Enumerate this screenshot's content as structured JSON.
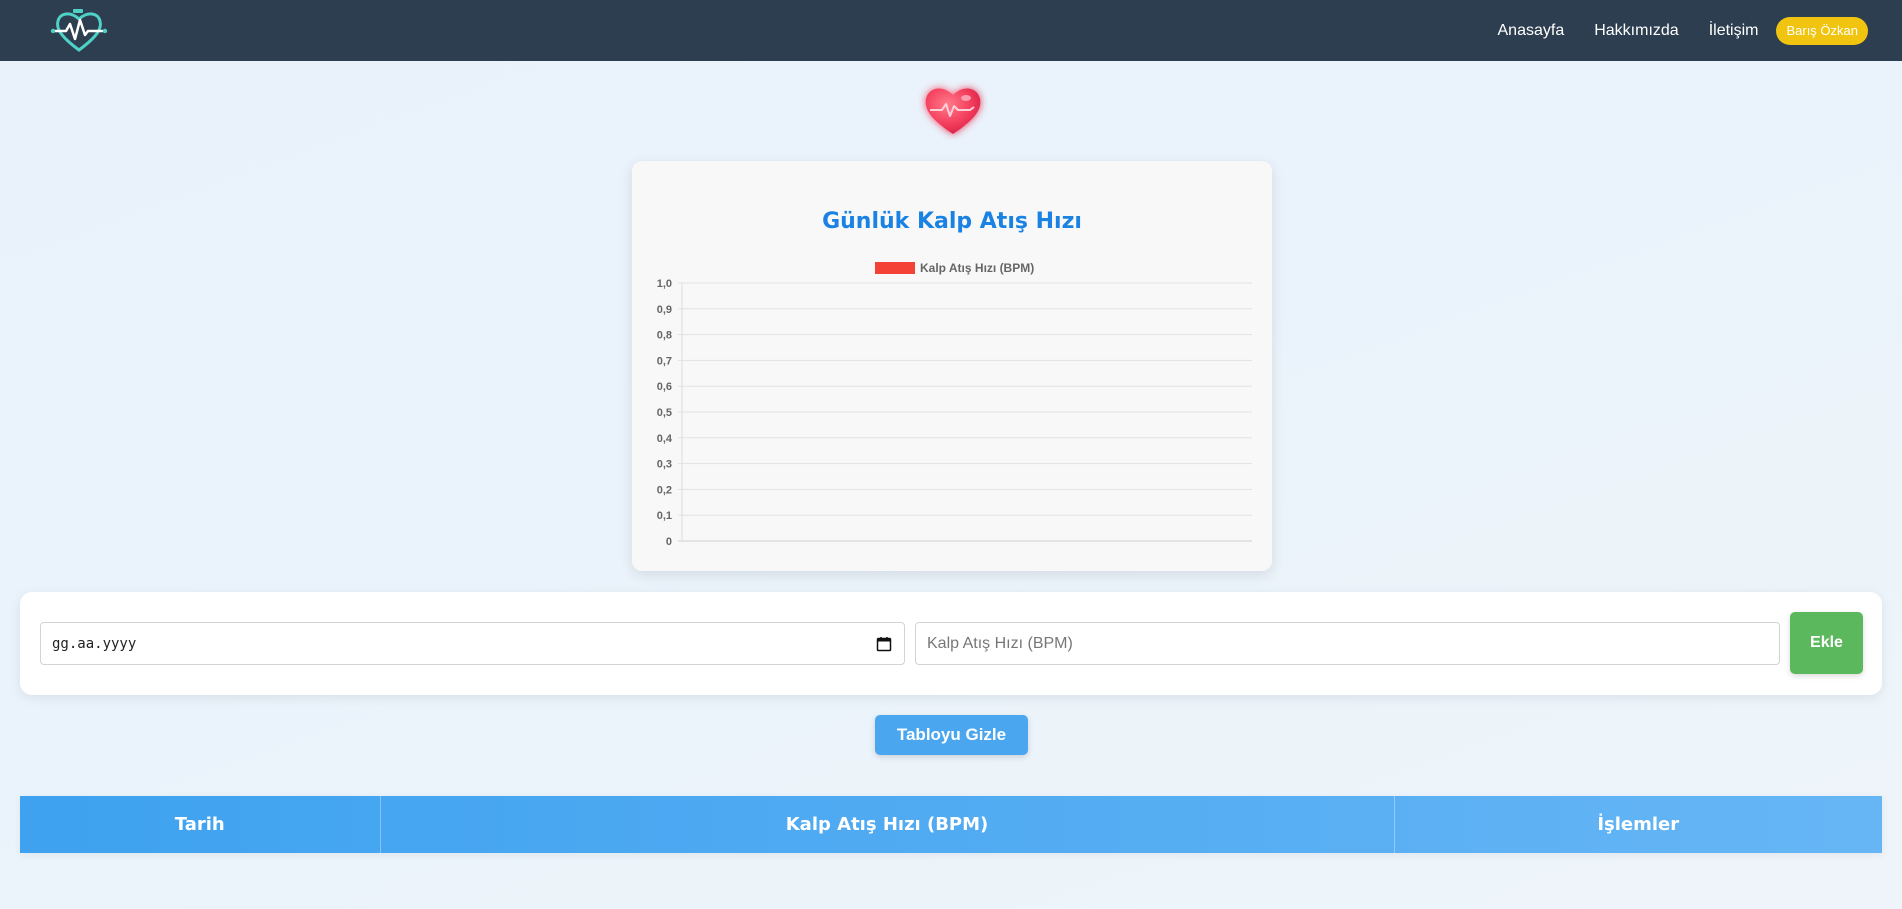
{
  "navbar": {
    "links": [
      "Anasayfa",
      "Hakkımızda",
      "İletişim"
    ],
    "user": "Barış Özkan",
    "bg_color": "#2c3e50",
    "user_badge_color": "#f1c40f"
  },
  "chart_data": {
    "type": "line",
    "title": "Günlük Kalp Atış Hızı",
    "series": [
      {
        "name": "Kalp Atış Hızı (BPM)",
        "color": "#f44336",
        "values": []
      }
    ],
    "categories": [],
    "ylim": [
      0,
      1
    ],
    "yticks": [
      "0",
      "0,1",
      "0,2",
      "0,3",
      "0,4",
      "0,5",
      "0,6",
      "0,7",
      "0,8",
      "0,9",
      "1,0"
    ],
    "grid": true,
    "legend": "top"
  },
  "form": {
    "date_placeholder": "gg.aa.yyyy",
    "bpm_placeholder": "Kalp Atış Hızı (BPM)",
    "add_label": "Ekle"
  },
  "toggle_table_label": "Tabloyu Gizle",
  "table": {
    "headers": [
      "Tarih",
      "Kalp Atış Hızı (BPM)",
      "İşlemler"
    ]
  },
  "colors": {
    "chart_title": "#1a82e2",
    "add_button": "#5cb85c",
    "toggle_button": "#4aa6ef",
    "table_header": "#3ea2f0"
  },
  "icons": {
    "logo": "heart-pulse-icon",
    "hero": "heart-pulse-icon",
    "date_picker": "calendar-icon"
  }
}
